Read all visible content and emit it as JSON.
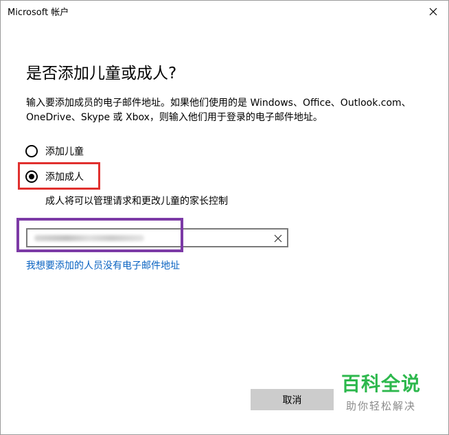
{
  "window": {
    "title": "Microsoft 帐户"
  },
  "heading": "是否添加儿童或成人?",
  "description": "输入要添加成员的电子邮件地址。如果他们使用的是 Windows、Office、Outlook.com、OneDrive、Skype 或 Xbox，则输入他们用于登录的电子邮件地址。",
  "options": [
    {
      "label": "添加儿童",
      "selected": false
    },
    {
      "label": "添加成人",
      "selected": true
    }
  ],
  "option_hint": "成人将可以管理请求和更改儿童的家长控制",
  "email_field": {
    "value": ""
  },
  "no_email_link": "我想要添加的人员没有电子邮件地址",
  "buttons": {
    "cancel": "取消"
  },
  "watermark": {
    "main": "百科全说",
    "sub": "助你轻松解决"
  },
  "colors": {
    "annotation_red": "#e0302e",
    "annotation_purple": "#7c3aa6",
    "link": "#0a63c2",
    "button_bg": "#cccccc",
    "watermark_green": "#2db84d"
  }
}
